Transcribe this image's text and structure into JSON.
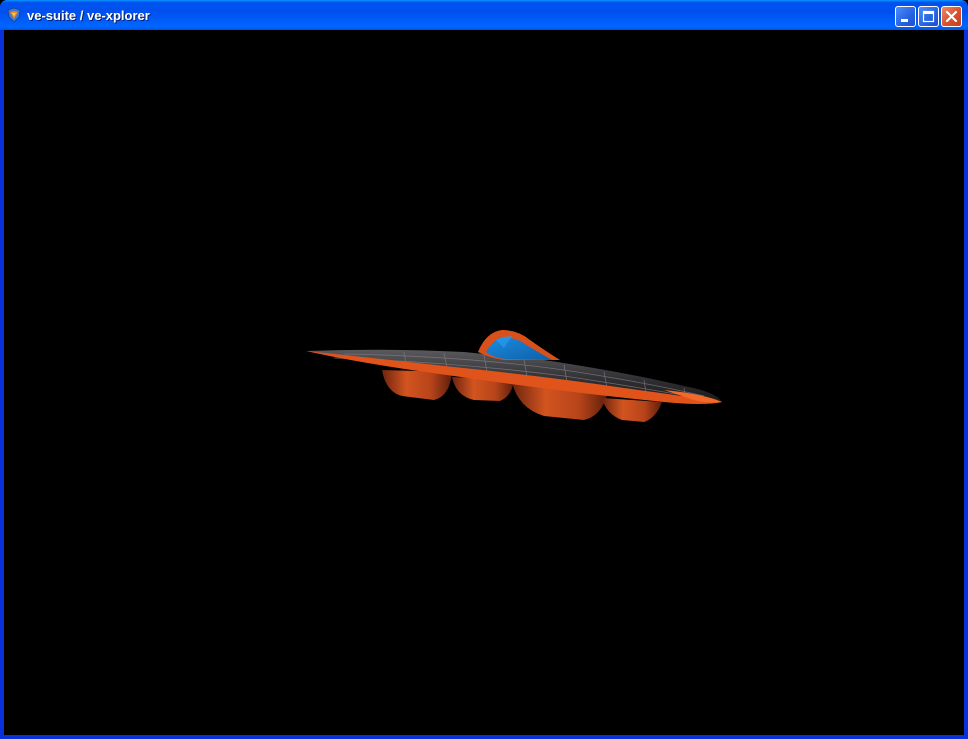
{
  "window": {
    "title": "ve-suite / ve-xplorer",
    "icon": "ve-suite-app-icon"
  },
  "titlebar_buttons": [
    {
      "name": "minimize",
      "icon": "minimize-icon"
    },
    {
      "name": "maximize",
      "icon": "maximize-icon"
    },
    {
      "name": "close",
      "icon": "close-icon"
    }
  ],
  "viewport": {
    "background": "#000000",
    "model": "streamlined vehicle with blue canopy and orange fairings",
    "colors": {
      "body": "#3a3a3c",
      "trim": "#e0541c",
      "canopy": "#1478c8",
      "fairing": "#c9461a"
    }
  }
}
